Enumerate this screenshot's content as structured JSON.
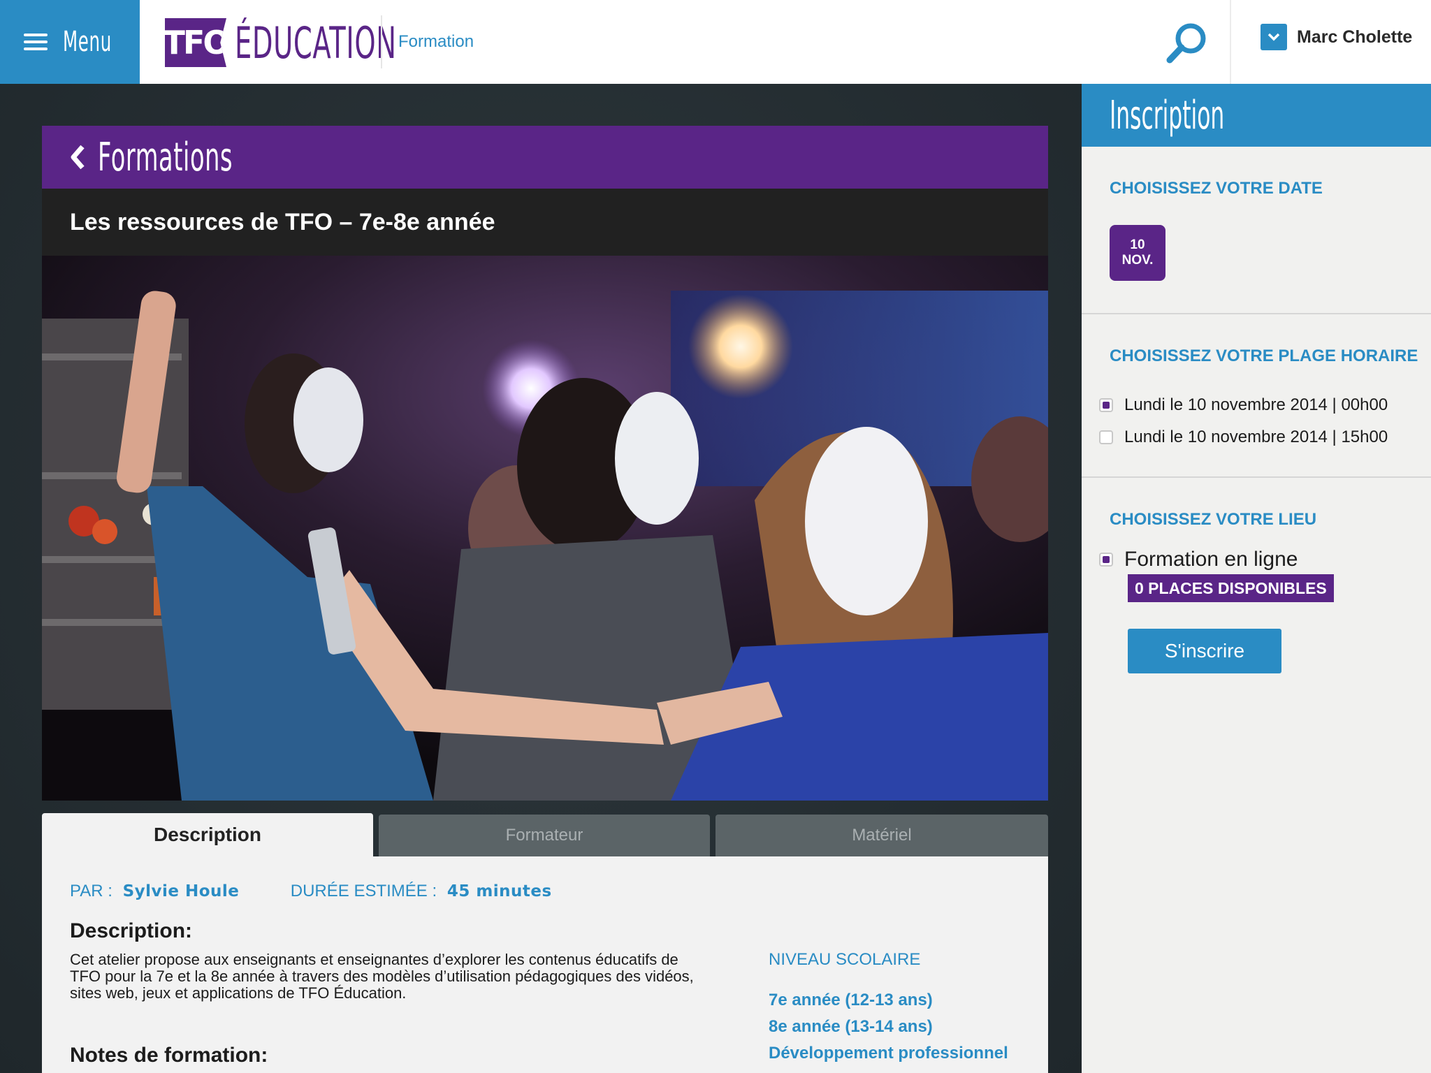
{
  "header": {
    "menu_label": "Menu",
    "logo_box": "TFO",
    "logo_text": "ÉDUCATION",
    "breadcrumb": "Formation",
    "user_name": "Marc Cholette",
    "icons": {
      "menu": "hamburger-icon",
      "search": "search-icon",
      "user": "chevron-down-icon"
    }
  },
  "course": {
    "back_label": "Formations",
    "title": "Les ressources de TFO – 7e-8e année",
    "tabs": [
      "Description",
      "Formateur",
      "Matériel"
    ],
    "par_label": "PAR :",
    "par_value": "Sylvie Houle",
    "duree_label": "DURÉE ESTIMÉE :",
    "duree_value": "45 minutes",
    "description_heading": "Description:",
    "description_text": "Cet atelier propose aux enseignants et enseignantes d’explorer les contenus éducatifs de TFO pour la 7e et la 8e année à travers des modèles d’utilisation pédagogiques des vidéos, sites web, jeux et applications de TFO Éducation.",
    "notes_heading": "Notes de formation:",
    "niveau_label": "NIVEAU SCOLAIRE",
    "niveaux": [
      "7e année (12-13 ans)",
      "8e année (13-14 ans)",
      "Développement professionnel"
    ]
  },
  "inscription": {
    "title": "Inscription",
    "date_title": "CHOISISSEZ VOTRE DATE",
    "date_day": "10",
    "date_month": "NOV.",
    "plage_title": "CHOISISSEZ VOTRE PLAGE HORAIRE",
    "plages": [
      {
        "label": "Lundi le 10 novembre 2014 | 00h00",
        "checked": true
      },
      {
        "label": "Lundi le 10 novembre 2014 | 15h00",
        "checked": false
      }
    ],
    "lieu_title": "CHOISISSEZ VOTRE LIEU",
    "lieu_label": "Formation en ligne",
    "places": "0 PLACES DISPONIBLES",
    "submit_label": "S'inscrire"
  },
  "colors": {
    "brand_blue": "#2a8cc4",
    "brand_purple": "#5a2587",
    "dark": "#212121"
  }
}
